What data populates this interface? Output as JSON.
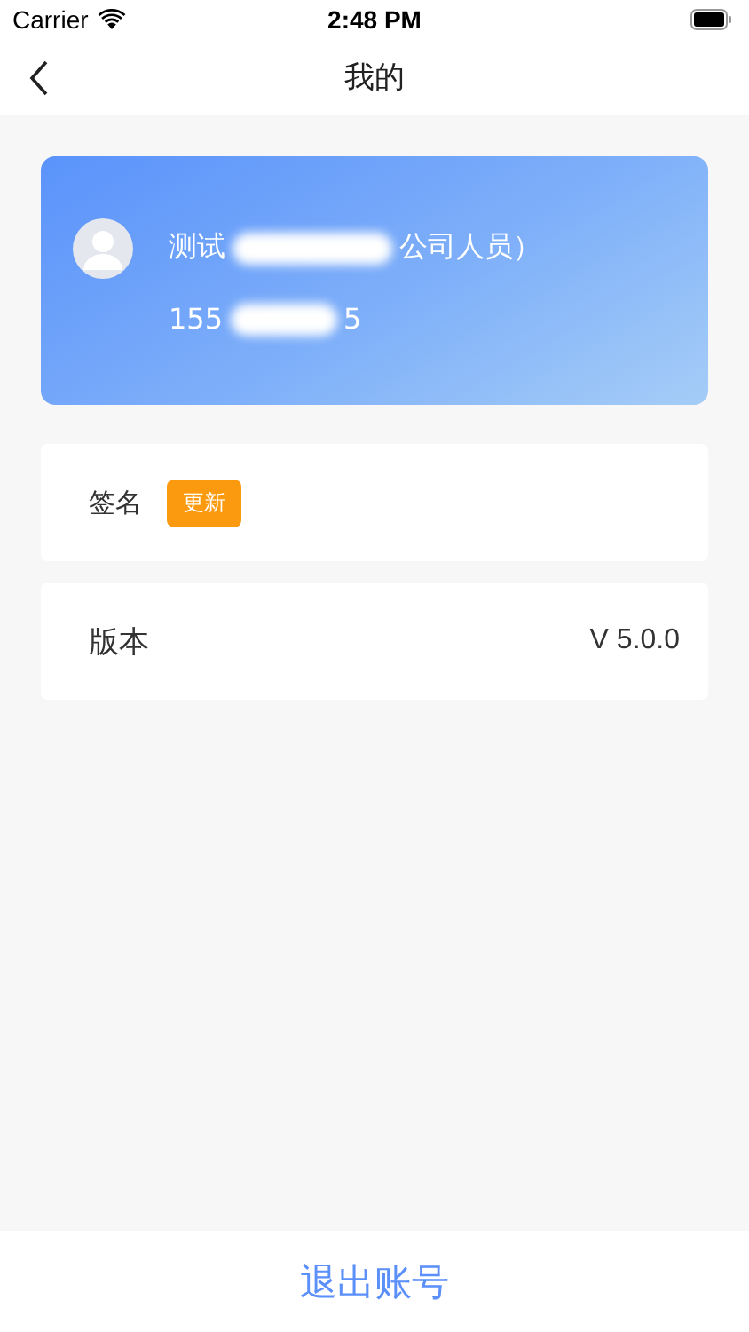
{
  "status_bar": {
    "carrier": "Carrier",
    "time": "2:48 PM"
  },
  "nav": {
    "title": "我的"
  },
  "profile": {
    "name_parts": [
      "测试",
      "公司人员）"
    ],
    "phone_parts": [
      "155",
      "5"
    ]
  },
  "rows": [
    {
      "kind": "badge",
      "label": "签名",
      "badge": "更新"
    },
    {
      "kind": "value",
      "label": "版本",
      "value": "V 5.0.0"
    }
  ],
  "logout": "退出账号"
}
